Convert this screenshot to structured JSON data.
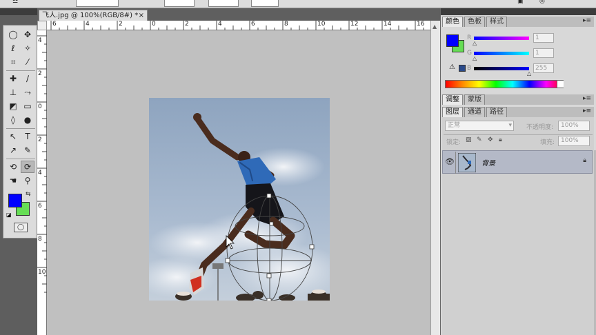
{
  "document": {
    "tab_title": "飞人.jpg @ 100%(RGB/8#) *",
    "close_glyph": "×"
  },
  "rulers": {
    "top_ticks": [
      "6",
      "4",
      "2",
      "0",
      "2",
      "4",
      "6",
      "8",
      "10",
      "12",
      "14",
      "16"
    ],
    "left_ticks": [
      "4",
      "2",
      "0",
      "2",
      "4",
      "6",
      "8",
      "10"
    ]
  },
  "tools": [
    {
      "name": "marquee-icon",
      "glyph": "◯"
    },
    {
      "name": "move-icon",
      "glyph": "✥"
    },
    {
      "name": "lasso-icon",
      "glyph": "ℓ"
    },
    {
      "name": "magic-wand-icon",
      "glyph": "✧"
    },
    {
      "name": "crop-icon",
      "glyph": "⌗"
    },
    {
      "name": "eyedropper-icon",
      "glyph": "⁄"
    },
    {
      "name": "healing-icon",
      "glyph": "✚"
    },
    {
      "name": "brush-icon",
      "glyph": "∕"
    },
    {
      "name": "stamp-icon",
      "glyph": "⊥"
    },
    {
      "name": "history-brush-icon",
      "glyph": "⤳"
    },
    {
      "name": "eraser-icon",
      "glyph": "◩"
    },
    {
      "name": "gradient-icon",
      "glyph": "▭"
    },
    {
      "name": "blur-icon",
      "glyph": "◊"
    },
    {
      "name": "dodge-icon",
      "glyph": "●"
    },
    {
      "name": "path-select-icon",
      "glyph": "↖"
    },
    {
      "name": "type-icon",
      "glyph": "T"
    },
    {
      "name": "direct-select-icon",
      "glyph": "↗"
    },
    {
      "name": "pen-icon",
      "glyph": "✎"
    },
    {
      "name": "rotate-3d-icon",
      "glyph": "⟲"
    },
    {
      "name": "orbit-3d-icon",
      "glyph": "⟳"
    },
    {
      "name": "hand-icon",
      "glyph": "☚"
    },
    {
      "name": "zoom-icon",
      "glyph": "⚲"
    }
  ],
  "colors": {
    "foreground": "#0000ff",
    "background": "#66dd55"
  },
  "color_panel": {
    "tabs": [
      "颜色",
      "色板",
      "样式"
    ],
    "channels": [
      {
        "label": "R",
        "value": "1"
      },
      {
        "label": "G",
        "value": "1"
      },
      {
        "label": "B",
        "value": "255"
      }
    ]
  },
  "adjust_panel": {
    "tabs": [
      "调整",
      "蒙版"
    ]
  },
  "layers_panel": {
    "tabs": [
      "图层",
      "通道",
      "路径"
    ],
    "blend_mode": "正常",
    "opacity_label": "不透明度:",
    "opacity_value": "100%",
    "lock_label": "锁定:",
    "fill_label": "填充:",
    "fill_value": "100%",
    "layer_name": "背景"
  }
}
